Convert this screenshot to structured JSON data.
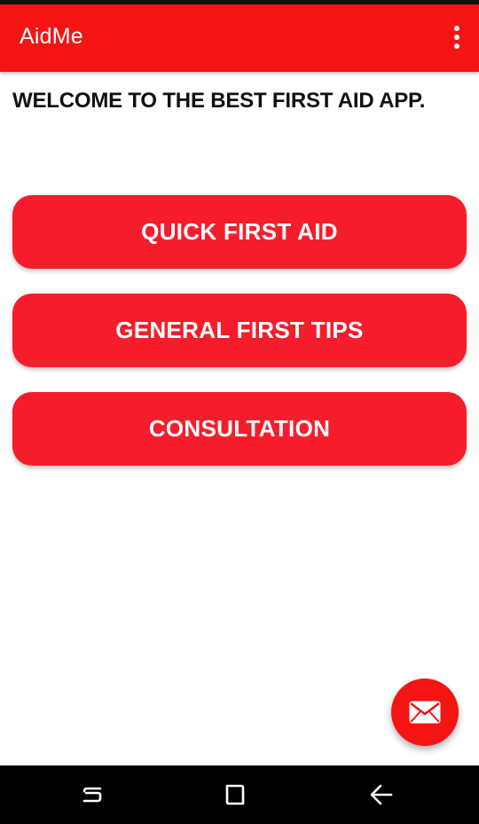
{
  "app_bar": {
    "title": "AidMe",
    "menu_icon": "overflow-menu-icon",
    "color": "#f41414"
  },
  "welcome": {
    "text": "WELCOME TO THE BEST FIRST AID APP."
  },
  "buttons": [
    {
      "label": "QUICK FIRST AID"
    },
    {
      "label": "GENERAL FIRST TIPS"
    },
    {
      "label": "CONSULTATION"
    }
  ],
  "button_color": "#f51d2c",
  "fab": {
    "icon": "email-icon"
  },
  "nav_bar": {
    "icons": [
      "recents-icon",
      "home-icon",
      "back-icon"
    ]
  }
}
